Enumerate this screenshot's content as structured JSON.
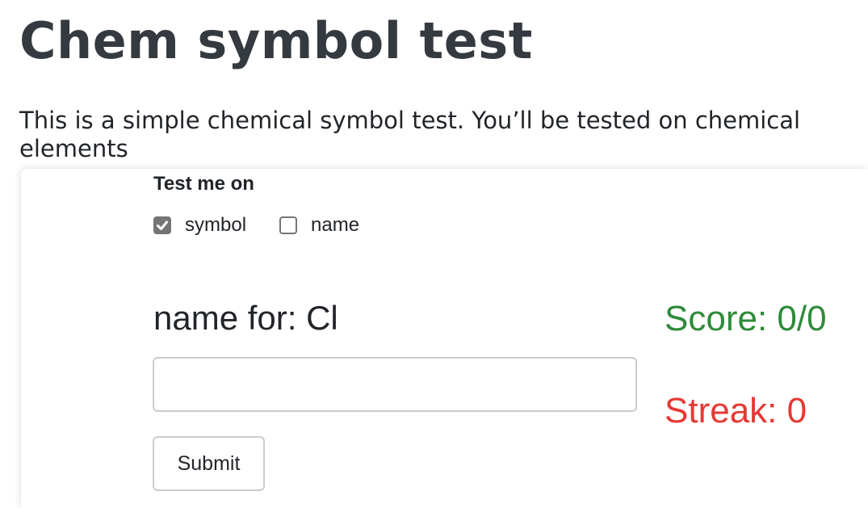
{
  "page": {
    "title": "Chem symbol test",
    "intro": "This is a simple chemical symbol test. You’ll be tested on chemical elements"
  },
  "form": {
    "legend": "Test me on",
    "options": [
      {
        "label": "symbol",
        "checked": true
      },
      {
        "label": "name",
        "checked": false
      }
    ],
    "prompt": "name for: Cl",
    "answer_value": "",
    "submit_label": "Submit"
  },
  "stats": {
    "score": "Score: 0/0",
    "streak": "Streak: 0",
    "score_color": "#2e8b3a",
    "streak_color": "#e53935"
  }
}
